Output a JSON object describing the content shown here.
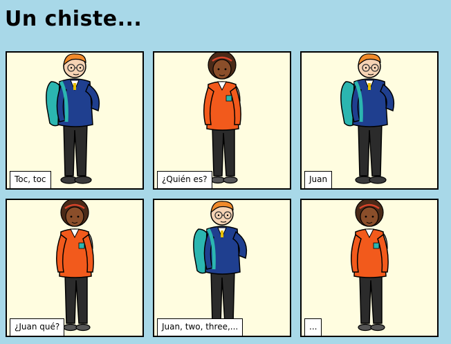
{
  "page": {
    "title": "Un chiste..."
  },
  "panels": [
    {
      "caption": "Toc, toc",
      "character": "boy"
    },
    {
      "caption": "¿Quién es?",
      "character": "girl"
    },
    {
      "caption": "Juan",
      "character": "boy"
    },
    {
      "caption": "¿Juan qué?",
      "character": "girl"
    },
    {
      "caption": "Juan, two, three,...",
      "character": "boy"
    },
    {
      "caption": "...",
      "character": "girl"
    }
  ],
  "colors": {
    "background": "#a8d8e8",
    "panel": "#fffde0",
    "sweater_blue": "#1f3f8f",
    "sweater_orange": "#f25a1c",
    "backpack": "#2bb6b0",
    "trousers": "#2b2b2b"
  }
}
